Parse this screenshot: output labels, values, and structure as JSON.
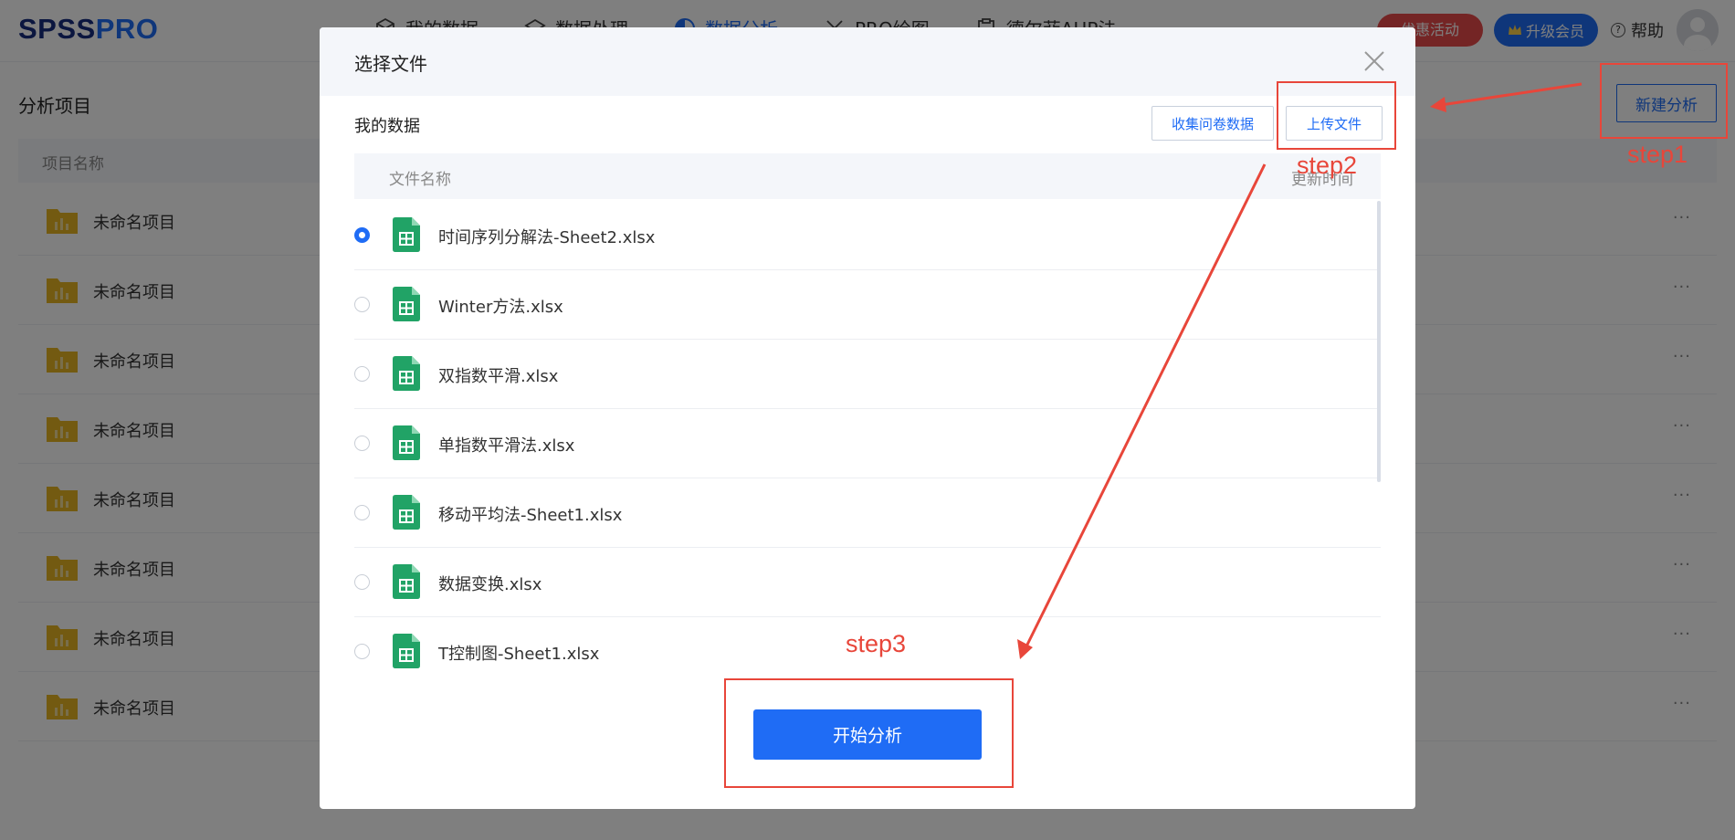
{
  "app": {
    "logo_part1": "SPSS",
    "logo_part2": "PRO",
    "nav": [
      {
        "label": "我的数据",
        "icon": "cube-icon"
      },
      {
        "label": "数据处理",
        "icon": "layers-icon"
      },
      {
        "label": "数据分析",
        "icon": "pie-chart-icon",
        "active": true
      },
      {
        "label": "PRO绘图",
        "icon": "brush-icon"
      },
      {
        "label": "德尔菲AHP法",
        "icon": "clipboard-icon"
      }
    ],
    "promo_label": "优惠活动",
    "vip_label": "升级会员",
    "help_label": "帮助"
  },
  "page": {
    "title": "分析项目",
    "new_analysis_label": "新建分析",
    "column_name": "项目名称",
    "projects": [
      {
        "name": "未命名项目"
      },
      {
        "name": "未命名项目"
      },
      {
        "name": "未命名项目"
      },
      {
        "name": "未命名项目"
      },
      {
        "name": "未命名项目"
      },
      {
        "name": "未命名项目"
      },
      {
        "name": "未命名项目"
      },
      {
        "name": "未命名项目"
      }
    ],
    "more_symbol": "···"
  },
  "modal": {
    "title": "选择文件",
    "section_title": "我的数据",
    "collect_label": "收集问卷数据",
    "upload_label": "上传文件",
    "col_file_name": "文件名称",
    "col_updated": "更新时间",
    "files": [
      {
        "name": "时间序列分解法-Sheet2.xlsx",
        "selected": true
      },
      {
        "name": "Winter方法.xlsx",
        "selected": false
      },
      {
        "name": "双指数平滑.xlsx",
        "selected": false
      },
      {
        "name": "单指数平滑法.xlsx",
        "selected": false
      },
      {
        "name": "移动平均法-Sheet1.xlsx",
        "selected": false
      },
      {
        "name": "数据变换.xlsx",
        "selected": false
      },
      {
        "name": "T控制图-Sheet1.xlsx",
        "selected": false
      }
    ],
    "start_label": "开始分析"
  },
  "annotations": {
    "step1": "step1",
    "step2": "step2",
    "step3": "step3",
    "color": "#e8463a"
  },
  "colors": {
    "accent": "#1f6cf5",
    "promo": "#e84a4a",
    "excel_green": "#21a366",
    "folder_yellow": "#e6b422"
  }
}
